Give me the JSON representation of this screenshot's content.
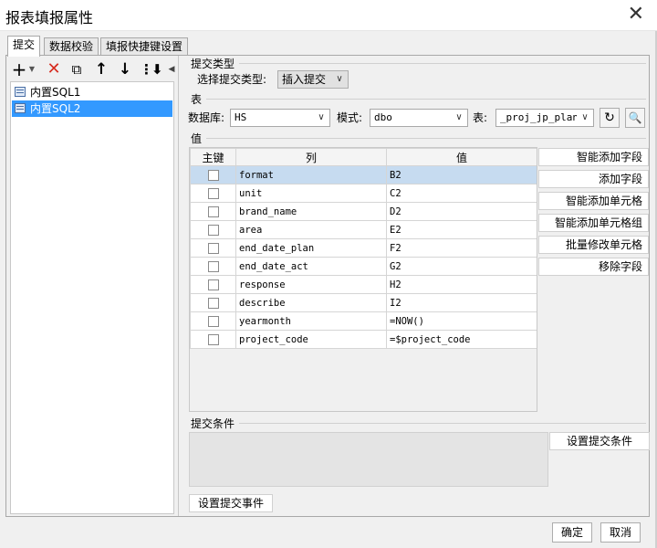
{
  "window": {
    "title": "报表填报属性"
  },
  "tabs": [
    {
      "label": "提交"
    },
    {
      "label": "数据校验"
    },
    {
      "label": "填报快捷键设置"
    }
  ],
  "tree": {
    "items": [
      {
        "label": "内置SQL1"
      },
      {
        "label": "内置SQL2"
      }
    ]
  },
  "submit_type": {
    "section": "提交类型",
    "label": "选择提交类型:",
    "value": "插入提交"
  },
  "table": {
    "section": "表",
    "db_label": "数据库:",
    "db_value": "HS",
    "schema_label": "模式:",
    "schema_value": "dbo",
    "table_label": "表:",
    "table_value": "t_proj_jp_plan"
  },
  "values": {
    "section": "值",
    "headers": [
      "主键",
      "列",
      "值"
    ],
    "rows": [
      {
        "column": "format",
        "value": "B2"
      },
      {
        "column": "unit",
        "value": "C2"
      },
      {
        "column": "brand_name",
        "value": "D2"
      },
      {
        "column": "area",
        "value": "E2"
      },
      {
        "column": "end_date_plan",
        "value": "F2"
      },
      {
        "column": "end_date_act",
        "value": "G2"
      },
      {
        "column": "response",
        "value": "H2"
      },
      {
        "column": "describe",
        "value": "I2"
      },
      {
        "column": "yearmonth",
        "value": "=NOW()"
      },
      {
        "column": "project_code",
        "value": "=$project_code"
      }
    ],
    "buttons": [
      "智能添加字段",
      "添加字段",
      "智能添加单元格",
      "智能添加单元格组",
      "批量修改单元格",
      "移除字段"
    ]
  },
  "conditions": {
    "section": "提交条件",
    "button": "设置提交条件"
  },
  "events": {
    "button": "设置提交事件"
  },
  "footer": {
    "ok": "确定",
    "cancel": "取消"
  },
  "colors": {
    "selection": "#3399ff",
    "row_highlight": "#c6dbf0",
    "delete_icon": "#d62b1f"
  }
}
